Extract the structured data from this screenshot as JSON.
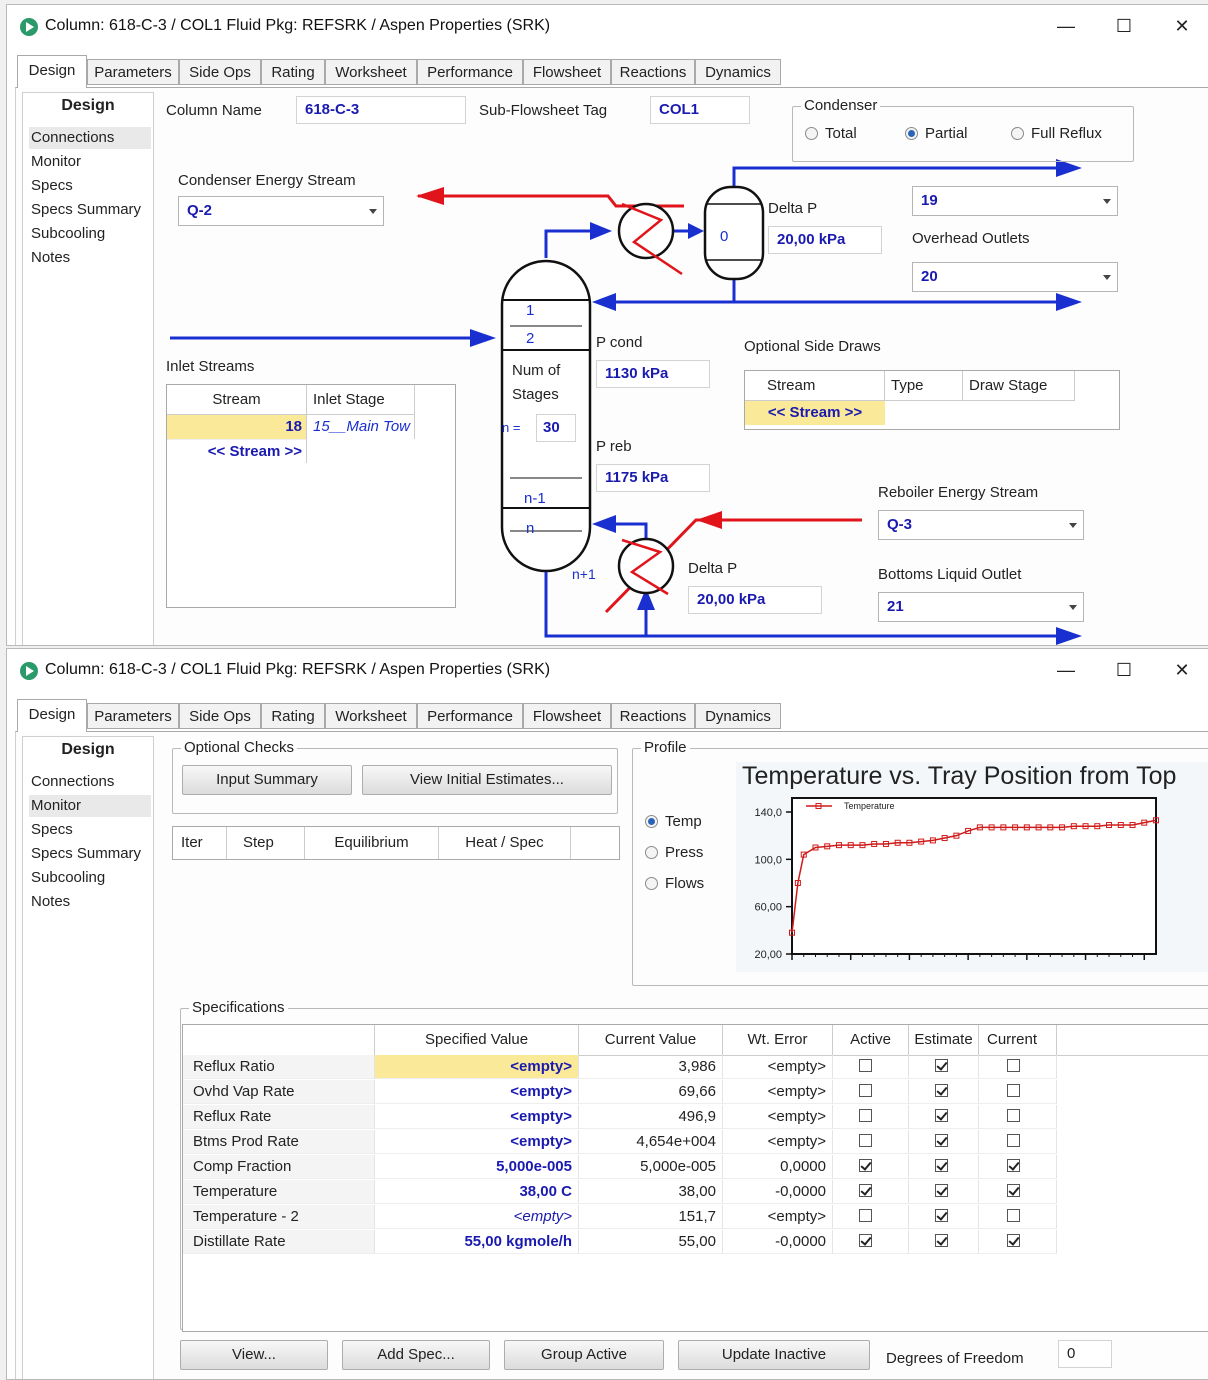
{
  "window1": {
    "title": "Column: 618-C-3 / COL1  Fluid Pkg: REFSRK / Aspen Properties (SRK)",
    "controls": {
      "minimize": "—",
      "maximize": "☐",
      "close": "✕"
    },
    "tabs": [
      "Design",
      "Parameters",
      "Side Ops",
      "Rating",
      "Worksheet",
      "Performance",
      "Flowsheet",
      "Reactions",
      "Dynamics"
    ],
    "nav": {
      "header": "Design",
      "items": [
        "Connections",
        "Monitor",
        "Specs",
        "Specs Summary",
        "Subcooling",
        "Notes"
      ]
    },
    "column_name_label": "Column Name",
    "column_name_value": "618-C-3",
    "subflowsheet_label": "Sub-Flowsheet Tag",
    "subflowsheet_value": "COL1",
    "condenser": {
      "group_label": "Condenser",
      "options": [
        "Total",
        "Partial",
        "Full Reflux"
      ],
      "selected": "Partial"
    },
    "condenser_energy_label": "Condenser Energy Stream",
    "condenser_energy_value": "Q-2",
    "top_delta_p_label": "Delta P",
    "top_delta_p_value": "20,00 kPa",
    "condenser_drum_label": "0",
    "vapour_outlet_value": "19",
    "overhead_outlets_label": "Overhead Outlets",
    "liquid_outlet_value": "20",
    "stage_labels": {
      "s1": "1",
      "s2": "2",
      "num_of": "Num of",
      "stages": "Stages",
      "n_eq": "n =",
      "n_minus_1": "n-1",
      "n": "n",
      "n_plus_1": "n+1"
    },
    "num_stages_value": "30",
    "p_cond_label": "P cond",
    "p_cond_value": "1130 kPa",
    "p_reb_label": "P reb",
    "p_reb_value": "1175 kPa",
    "inlet_streams": {
      "label": "Inlet Streams",
      "headers": [
        "Stream",
        "Inlet Stage"
      ],
      "rows": [
        {
          "stream": "18",
          "stage": "15__Main Tow"
        }
      ],
      "new_row": "<< Stream >>"
    },
    "side_draws": {
      "label": "Optional Side Draws",
      "headers": [
        "Stream",
        "Type",
        "Draw Stage"
      ],
      "new_row": "<< Stream >>"
    },
    "reboiler_energy_label": "Reboiler Energy Stream",
    "reboiler_energy_value": "Q-3",
    "bottom_delta_p_label": "Delta P",
    "bottom_delta_p_value": "20,00 kPa",
    "bottoms_liquid_label": "Bottoms Liquid Outlet",
    "bottoms_liquid_value": "21",
    "colors": {
      "material_stream": "#1a2fd0",
      "energy_stream": "#e0141a"
    }
  },
  "window2": {
    "title": "Column: 618-C-3 / COL1  Fluid Pkg: REFSRK / Aspen Properties (SRK)",
    "controls": {
      "minimize": "—",
      "maximize": "☐",
      "close": "✕"
    },
    "tabs": [
      "Design",
      "Parameters",
      "Side Ops",
      "Rating",
      "Worksheet",
      "Performance",
      "Flowsheet",
      "Reactions",
      "Dynamics"
    ],
    "nav": {
      "header": "Design",
      "items": [
        "Connections",
        "Monitor",
        "Specs",
        "Specs Summary",
        "Subcooling",
        "Notes"
      ],
      "selected": "Monitor"
    },
    "optional_checks": {
      "label": "Optional Checks",
      "input_summary": "Input Summary",
      "view_initial": "View Initial Estimates..."
    },
    "iter_headers": [
      "Iter",
      "Step",
      "Equilibrium",
      "Heat / Spec"
    ],
    "profile": {
      "label": "Profile",
      "options": [
        "Temp",
        "Press",
        "Flows"
      ],
      "selected": "Temp"
    },
    "specifications": {
      "label": "Specifications",
      "headers": [
        "",
        "Specified Value",
        "Current Value",
        "Wt. Error",
        "Active",
        "Estimate",
        "Current"
      ],
      "rows": [
        {
          "name": "Reflux Ratio",
          "specified": "<empty>",
          "current": "3,986",
          "error": "<empty>",
          "active": false,
          "estimate": true,
          "current_chk": false
        },
        {
          "name": "Ovhd Vap Rate",
          "specified": "<empty>",
          "current": "69,66",
          "error": "<empty>",
          "active": false,
          "estimate": true,
          "current_chk": false
        },
        {
          "name": "Reflux Rate",
          "specified": "<empty>",
          "current": "496,9",
          "error": "<empty>",
          "active": false,
          "estimate": true,
          "current_chk": false
        },
        {
          "name": "Btms Prod Rate",
          "specified": "<empty>",
          "current": "4,654e+004",
          "error": "<empty>",
          "active": false,
          "estimate": true,
          "current_chk": false
        },
        {
          "name": "Comp Fraction",
          "specified": "5,000e-005",
          "current": "5,000e-005",
          "error": "0,0000",
          "active": true,
          "estimate": true,
          "current_chk": true
        },
        {
          "name": "Temperature",
          "specified": "38,00 C",
          "current": "38,00",
          "error": "-0,0000",
          "active": true,
          "estimate": true,
          "current_chk": true
        },
        {
          "name": "Temperature - 2",
          "specified": "<empty>",
          "current": "151,7",
          "error": "<empty>",
          "active": false,
          "estimate": true,
          "current_chk": false
        },
        {
          "name": "Distillate Rate",
          "specified": "55,00 kgmole/h",
          "current": "55,00",
          "error": "-0,0000",
          "active": true,
          "estimate": true,
          "current_chk": true
        }
      ]
    },
    "buttons": [
      "View...",
      "Add Spec...",
      "Group Active",
      "Update Inactive"
    ],
    "dof_label": "Degrees of Freedom",
    "dof_value": "0"
  },
  "chart_data": {
    "type": "line",
    "title": "Temperature vs. Tray Position from Top",
    "xlabel": "",
    "ylabel": "",
    "xlim": [
      0,
      35
    ],
    "ylim": [
      20,
      140
    ],
    "xticks": [
      "0",
      "5",
      "10",
      "15",
      "20",
      "25",
      "30",
      "3"
    ],
    "yticks": [
      "140,0",
      "100,0",
      "60,00",
      "20,00"
    ],
    "legend": "top-left",
    "grid": true,
    "series": [
      {
        "name": "Temperature",
        "color": "#d01a1a",
        "x": [
          0,
          0.5,
          1,
          2,
          3,
          4,
          5,
          6,
          7,
          8,
          9,
          10,
          11,
          12,
          13,
          14,
          15,
          16,
          17,
          18,
          19,
          20,
          21,
          22,
          23,
          24,
          25,
          26,
          27,
          28,
          29,
          30,
          31
        ],
        "y": [
          38,
          80,
          104,
          110,
          111,
          112,
          112,
          112,
          113,
          113,
          114,
          114,
          115,
          116,
          118,
          120,
          124,
          127,
          127,
          127,
          127,
          127,
          127,
          127,
          127,
          128,
          128,
          128,
          129,
          129,
          129,
          131,
          133
        ]
      }
    ]
  }
}
